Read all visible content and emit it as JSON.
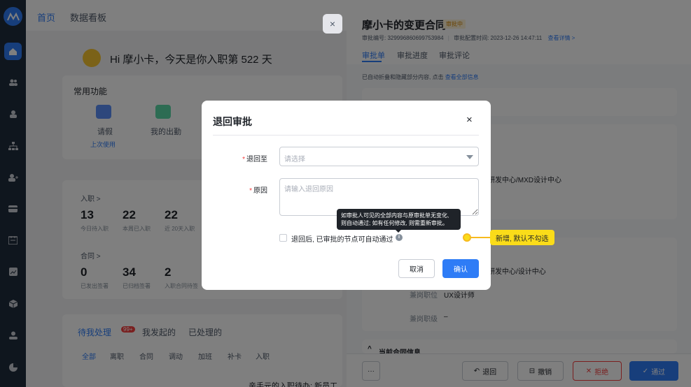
{
  "main": {
    "top_tabs": [
      "首页",
      "数据看板"
    ],
    "greeting": "Hi 摩小卡，今天是你入职第 522 天",
    "common_functions": {
      "title": "常用功能",
      "items": [
        {
          "label": "请假",
          "sub": "上次使用"
        },
        {
          "label": "我的出勤"
        }
      ]
    },
    "onboarding": {
      "title": "入职 >",
      "stats": [
        {
          "value": "13",
          "label": "今日待入职"
        },
        {
          "value": "22",
          "label": "本周已入职"
        },
        {
          "value": "22",
          "label": "近 20天入职"
        }
      ]
    },
    "contract": {
      "title": "合同 >",
      "stats": [
        {
          "value": "0",
          "label": "已发出签署"
        },
        {
          "value": "34",
          "label": "已归档签署"
        },
        {
          "value": "2",
          "label": "入职合同待签"
        }
      ]
    },
    "todo_tabs": {
      "items": [
        "待我处理",
        "我发起的",
        "已处理的"
      ],
      "count_badge": "99+"
    },
    "todo_subtabs": [
      "全部",
      "离职",
      "合同",
      "调动",
      "加班",
      "补卡",
      "入职"
    ],
    "bottom_snippet": "亲手元的入职待办: 新员工"
  },
  "drawer": {
    "title": "摩小卡的变更合同",
    "status_badge": "审批中",
    "meta_prefix": "审批编号: 329996860699753984",
    "meta_time": "审批配置时间: 2023-12-26 14:47:11",
    "meta_link": "查看详情 >",
    "tabs": [
      "审批单",
      "审批进度",
      "审批评论"
    ],
    "note_prefix": "已自动折叠和隐藏部分内容, 点击",
    "note_link": "查看全部信息",
    "dept_1": "研发中心/MXD设计中心",
    "dept_2": "研发中心/设计中心",
    "rows": [
      {
        "key": "兼岗职位",
        "value": "UX设计师"
      },
      {
        "key": "兼岗职级",
        "value": "–"
      }
    ],
    "current_contract": "当前合同信息",
    "footer": {
      "more": "···",
      "back": "退回",
      "withdraw": "撤销",
      "reject": "拒绝",
      "approve": "通过"
    }
  },
  "modal": {
    "title": "退回审批",
    "close": "×",
    "return_to_label": "退回至",
    "return_to_placeholder": "请选择",
    "reason_label": "原因",
    "reason_placeholder": "请输入退回原因",
    "tooltip_line1": "如审批人可见的全部内容与原审批单无变化,",
    "tooltip_line2": "则自动通过; 如有任何修改, 则需重新审批。",
    "auto_pass_label": "退回后, 已审批的节点可自动通过",
    "cancel": "取消",
    "confirm": "确认"
  },
  "annotation": {
    "text": "新增, 默认不勾选"
  },
  "colors": {
    "primary": "#2e7cf6",
    "danger": "#f53f3f",
    "annotation": "#fadc19",
    "rail": "#1f2d3d"
  }
}
